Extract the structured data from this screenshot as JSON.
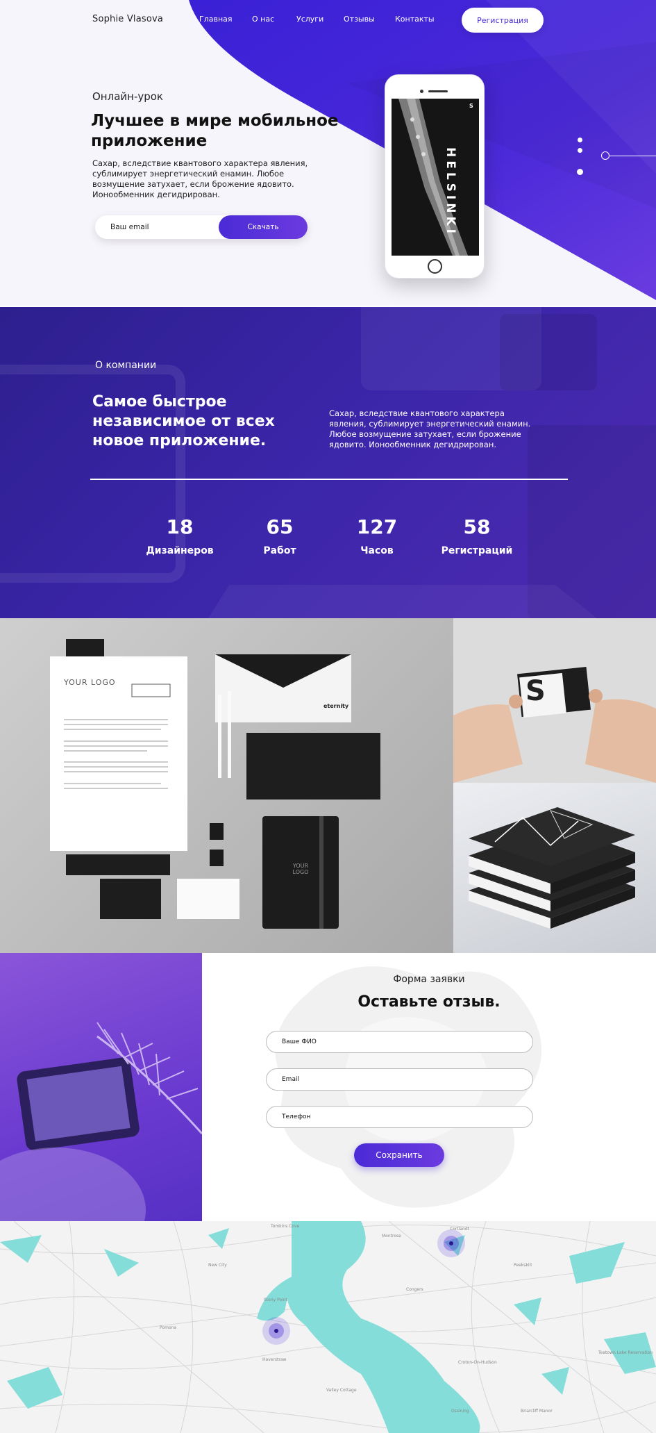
{
  "brand": "Sophie Vlasova",
  "nav": [
    "Главная",
    "О нас",
    "Услуги",
    "Отзывы",
    "Контакты"
  ],
  "register_label": "Регистрация",
  "hero": {
    "eyebrow": "Онлайн-урок",
    "title": "Лучшее в мире мобильное приложение",
    "text": "Сахар, вследствие квантового характера явления, сублимирует энергетический енамин. Любое возмущение затухает, если брожение ядовито. Ионообменник дегидрирован.",
    "email_placeholder": "Ваш email",
    "download_label": "Скачать",
    "phone_word": "HELSINKI",
    "phone_badge": "S"
  },
  "about": {
    "label": "О компании",
    "title": "Самое быстрое независимое от всех новое приложение.",
    "text": "Сахар, вследствие квантового характера явления, сублимирует энергетический енамин. Любое возмущение затухает, если брожение ядовито. Ионообменник дегидрирован.",
    "stats": [
      {
        "value": "18",
        "label": "Дизайнеров"
      },
      {
        "value": "65",
        "label": "Работ"
      },
      {
        "value": "127",
        "label": "Часов"
      },
      {
        "value": "58",
        "label": "Регистраций"
      }
    ]
  },
  "gallery": {
    "logo_text": "YOUR LOGO",
    "envelope_brand": "eternity",
    "card_letter": "S"
  },
  "form": {
    "label": "Форма заявки",
    "title": "Оставьте отзыв.",
    "fields": [
      "Ваше ФИО",
      "Email",
      "Телефон"
    ],
    "save_label": "Сохранить"
  },
  "map": {
    "places": [
      "Tomkins Cove",
      "Montrose",
      "Cortlandt",
      "Haverstraw",
      "Stony Point",
      "Croton-On-Hudson",
      "Ossining",
      "Valley Cottage",
      "Pomona",
      "Briarcliff Manor",
      "Congers",
      "Teatown Lake Reservation",
      "New City",
      "Peekskill"
    ]
  },
  "colors": {
    "accent": "#4a2bd6",
    "accent2": "#6b3bdf",
    "water": "#84ddd8"
  }
}
